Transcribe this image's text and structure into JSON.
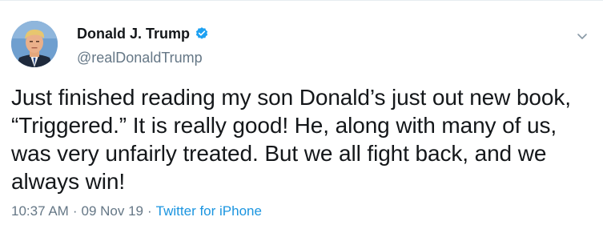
{
  "tweet": {
    "display_name": "Donald J. Trump",
    "handle": "@realDonaldTrump",
    "text": "Just finished reading my son Donald’s just out new book, “Triggered.” It is really good! He, along with many of us, was very unfairly treated. But we all fight back, and we always win!",
    "time": "10:37 AM",
    "separator_1": "·",
    "date": "09 Nov 19",
    "separator_2": "·",
    "source": "Twitter for iPhone"
  },
  "icons": {
    "verified": "verified-badge-icon",
    "caret": "chevron-down-icon",
    "avatar": "profile-photo"
  },
  "colors": {
    "text": "#14171a",
    "secondary": "#657786",
    "link": "#1b95e0",
    "verified": "#1da1f2"
  }
}
